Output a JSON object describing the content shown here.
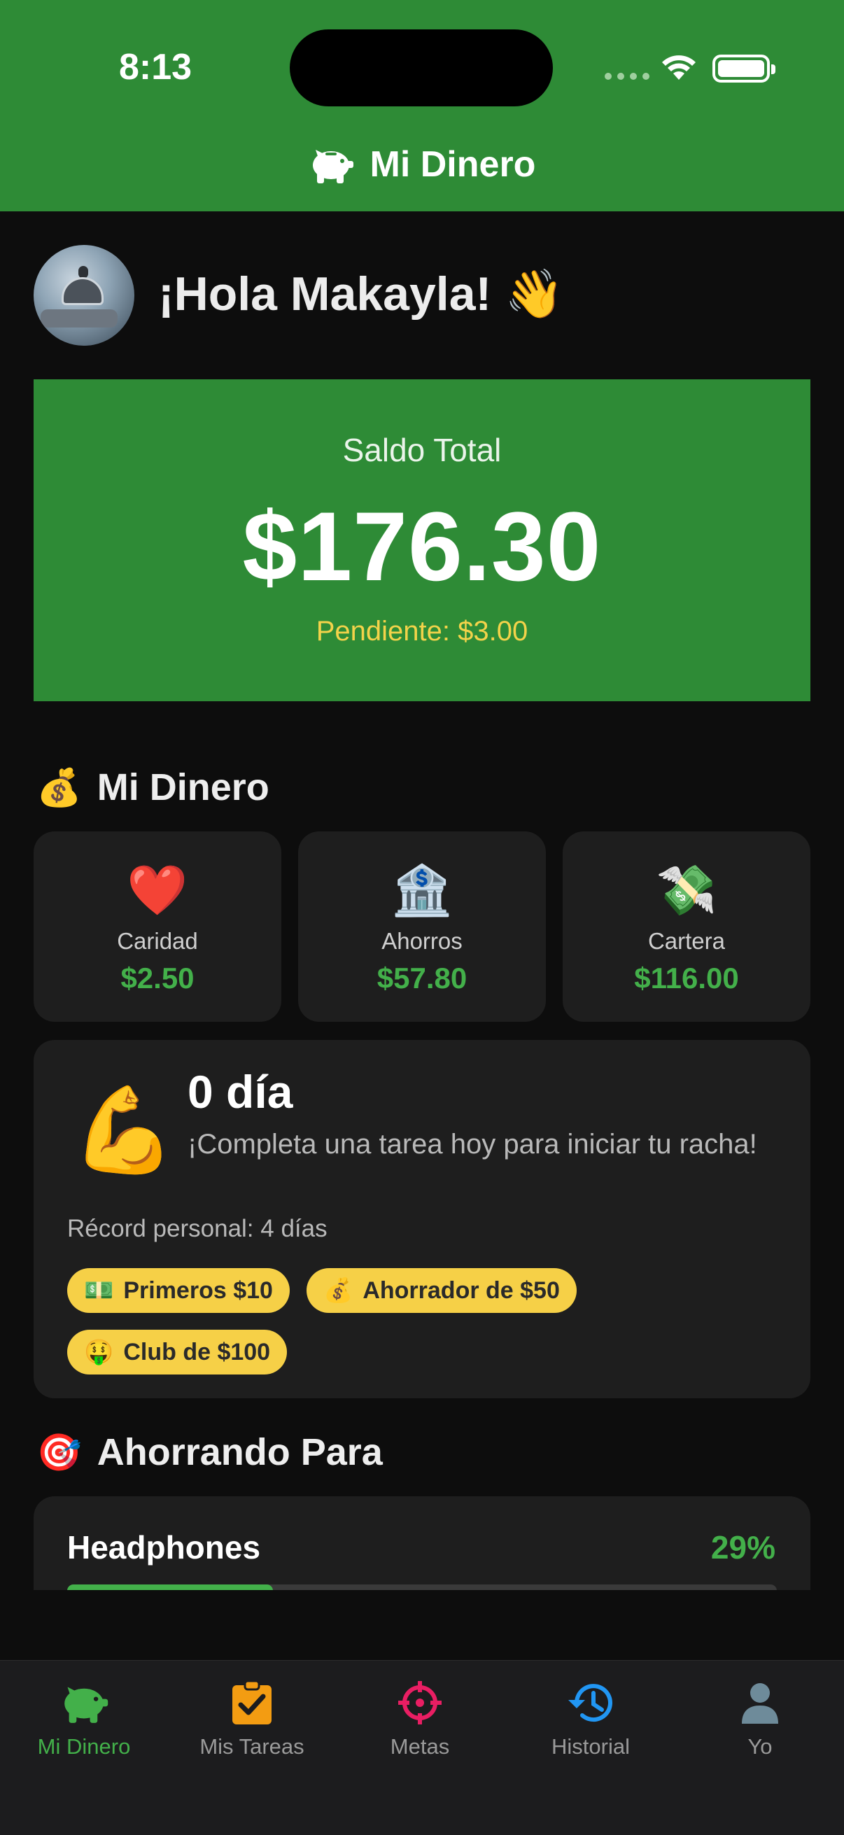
{
  "status_bar": {
    "time": "8:13"
  },
  "header": {
    "title": "Mi Dinero",
    "icon": "piggy-bank-icon"
  },
  "greeting": {
    "text": "¡Hola Makayla! 👋"
  },
  "balance": {
    "label": "Saldo Total",
    "amount": "$176.30",
    "pending": "Pendiente: $3.00"
  },
  "money_section": {
    "title": "Mi Dinero",
    "emoji": "💰",
    "boxes": [
      {
        "icon": "❤️",
        "label": "Caridad",
        "value": "$2.50"
      },
      {
        "icon": "🏦",
        "label": "Ahorros",
        "value": "$57.80"
      },
      {
        "icon": "💸",
        "label": "Cartera",
        "value": "$116.00"
      }
    ]
  },
  "streak": {
    "emoji": "💪",
    "days": "0 día",
    "message": "¡Completa una tarea hoy para iniciar tu racha!",
    "record": "Récord personal: 4 días",
    "badges": [
      {
        "emoji": "💵",
        "label": "Primeros $10"
      },
      {
        "emoji": "💰",
        "label": "Ahorrador de $50"
      },
      {
        "emoji": "🤑",
        "label": "Club de $100"
      }
    ]
  },
  "goals_section": {
    "title": "Ahorrando Para",
    "emoji": "🎯",
    "goals": [
      {
        "name": "Headphones",
        "percent_label": "29%",
        "progress": 0.29
      }
    ]
  },
  "tabs": [
    {
      "label": "Mi Dinero",
      "icon": "piggy-bank-icon",
      "color": "#43b04a",
      "active": true
    },
    {
      "label": "Mis Tareas",
      "icon": "clipboard-check-icon",
      "color": "#f39c12",
      "active": false
    },
    {
      "label": "Metas",
      "icon": "crosshair-icon",
      "color": "#e91e63",
      "active": false
    },
    {
      "label": "Historial",
      "icon": "history-icon",
      "color": "#2196f3",
      "active": false
    },
    {
      "label": "Yo",
      "icon": "person-icon",
      "color": "#6e8b9a",
      "active": false
    }
  ],
  "colors": {
    "brand_green": "#2e8b36",
    "money_green": "#43b04a",
    "pending_yellow": "#f3d34a",
    "badge_yellow": "#f6d047"
  }
}
